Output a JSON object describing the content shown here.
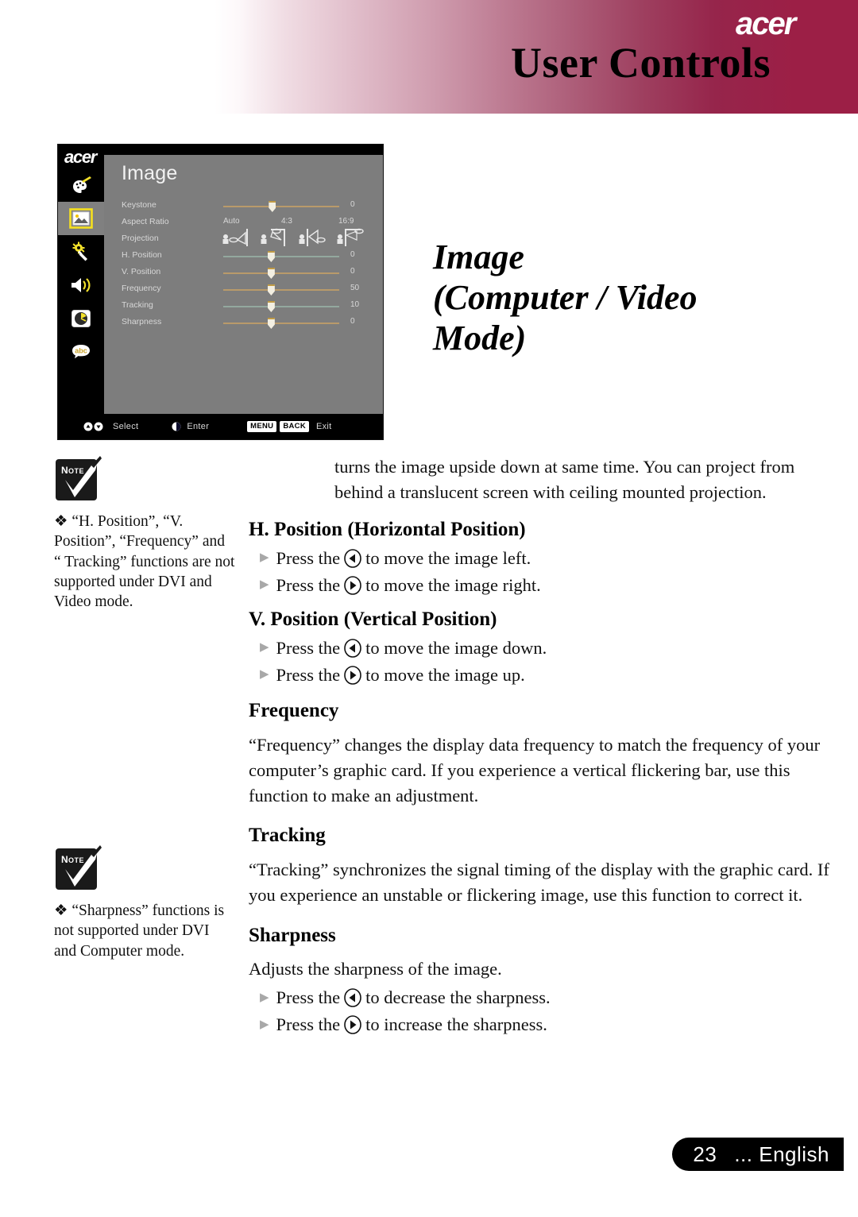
{
  "header": {
    "title": "User Controls",
    "brand": "acer",
    "band_color": "#9c1f46"
  },
  "page_title": {
    "line1": "Image",
    "line2": "(Computer / Video",
    "line3": "Mode)"
  },
  "osd": {
    "brand": "acer",
    "menu_title": "Image",
    "sidebar": [
      {
        "name": "color-icon",
        "label": "Color"
      },
      {
        "name": "image-icon",
        "label": "Image",
        "selected": true
      },
      {
        "name": "setup-icon",
        "label": "Management"
      },
      {
        "name": "audio-icon",
        "label": "Audio"
      },
      {
        "name": "timer-icon",
        "label": "Timer"
      },
      {
        "name": "language-icon",
        "label": "Language"
      }
    ],
    "rows": [
      {
        "label": "Keystone",
        "type": "slider",
        "value": "0",
        "pos": 42,
        "track": "gold"
      },
      {
        "label": "Aspect Ratio",
        "type": "options",
        "options": [
          "Auto",
          "4:3",
          "16:9"
        ]
      },
      {
        "label": "Projection",
        "type": "projection",
        "modes": [
          "front",
          "rear",
          "front-ceiling",
          "rear-ceiling"
        ]
      },
      {
        "label": "H. Position",
        "type": "slider",
        "value": "0",
        "pos": 41,
        "track": "blue"
      },
      {
        "label": "V. Position",
        "type": "slider",
        "value": "0",
        "pos": 41,
        "track": "gold"
      },
      {
        "label": "Frequency",
        "type": "slider",
        "value": "50",
        "pos": 41,
        "track": "gold"
      },
      {
        "label": "Tracking",
        "type": "slider",
        "value": "10",
        "pos": 41,
        "track": "blue"
      },
      {
        "label": "Sharpness",
        "type": "slider",
        "value": "0",
        "pos": 41,
        "track": "gold"
      }
    ],
    "footer": {
      "select_label": "Select",
      "enter_label": "Enter",
      "menu_key": "MENU",
      "back_key": "BACK",
      "exit_label": "Exit"
    }
  },
  "notes": [
    {
      "icon_label": "Note",
      "text": "❖ “H. Position”, “V. Position”, “Frequency” and “ Tracking” functions are not supported under DVI and Video mode."
    },
    {
      "icon_label": "Note",
      "text": "❖ “Sharpness” functions is not supported under DVI and Computer mode."
    }
  ],
  "content": {
    "intro": "turns the image upside down at same time. You can project from behind a translucent screen with ceiling mounted projection.",
    "sections": [
      {
        "heading": "H. Position (Horizontal Position)",
        "bullets": [
          {
            "pre": "Press the",
            "icon": "left-arrow-button",
            "post": "to move the image left."
          },
          {
            "pre": "Press the",
            "icon": "right-arrow-button",
            "post": "to move the image right."
          }
        ]
      },
      {
        "heading": "V. Position (Vertical Position)",
        "bullets": [
          {
            "pre": "Press the",
            "icon": "left-arrow-button",
            "post": "to move the image down."
          },
          {
            "pre": "Press the",
            "icon": "right-arrow-button",
            "post": "to move the image up."
          }
        ]
      },
      {
        "heading": "Frequency",
        "body": "“Frequency” changes the display data frequency to match the frequency of your computer’s graphic card. If you experience a vertical flickering bar, use this function to make an adjustment."
      },
      {
        "heading": "Tracking",
        "body": "“Tracking” synchronizes the signal timing of the display with the graphic card. If you experience an unstable or flickering image, use this function to correct it."
      },
      {
        "heading": "Sharpness",
        "body": "Adjusts the sharpness of the image.",
        "bullets": [
          {
            "pre": "Press the",
            "icon": "left-arrow-button",
            "post": "to decrease the sharpness."
          },
          {
            "pre": "Press the",
            "icon": "right-arrow-button",
            "post": "to increase the sharpness."
          }
        ]
      }
    ]
  },
  "footer": {
    "page_number": "23",
    "language": "... English"
  }
}
